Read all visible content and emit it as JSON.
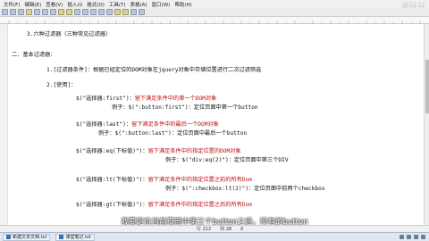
{
  "app": {
    "menu": [
      "文件(F)",
      "编辑(E)",
      "查看(V)",
      "插入(I)",
      "格式(O)",
      "工具(T)",
      "表格(A)",
      "窗口(W)",
      "帮助(H)"
    ],
    "watermark": "尚硅谷"
  },
  "doc": {
    "heading3": "3.六种过滤器（三种常见过滤器）",
    "section2": "二．基本过滤器：",
    "item1": "1.[过滤器条件]：根据已经定位的DOM对象在jquery对象中存储位置进行二次过滤筛选",
    "item2": "2.[使用]：",
    "first_sel": "$(\"选择器:first\")：",
    "first_desc": "留下满足条件中的第一个DOM对象",
    "first_ex": "例子：$(\":button:first\")：定位页面中第一个button",
    "last_sel": "$(\"选择器:last\")：",
    "last_desc": "留下满足条件中的最后一个DOM对象",
    "last_ex": "例子：$(\":button:last\")：定位页面中最后一个button",
    "eq_sel": "$(\"选择器:eq(下标值)\")：",
    "eq_desc": "留下满足条件中的指定位置的DOM对象",
    "eq_ex": "例子：$(\"div:eq(2)\")：定位页面中第三个DIV",
    "lt_sel": "$(\"选择器:lt(下标值)\")：",
    "lt_desc": "留下满足条件中的指定位置之前的所有Dom",
    "lt_ex": "例子：$(\":checkbox:lt(2)\")：定位页面中前两个checkbox",
    "gt_sel": "$(\"选择器:gt(下标值)\")：",
    "gt_desc": "留下满足条件中的指定位置之后的所有Dom"
  },
  "subtitle": "我要定位当前页面中第三个button之后，所有的button",
  "status": {
    "line": "行 212",
    "col": "列 28",
    "sel": "0"
  },
  "taskbar": {
    "items": [
      "新建文本文档.txt",
      "课堂笔记.txt"
    ]
  }
}
